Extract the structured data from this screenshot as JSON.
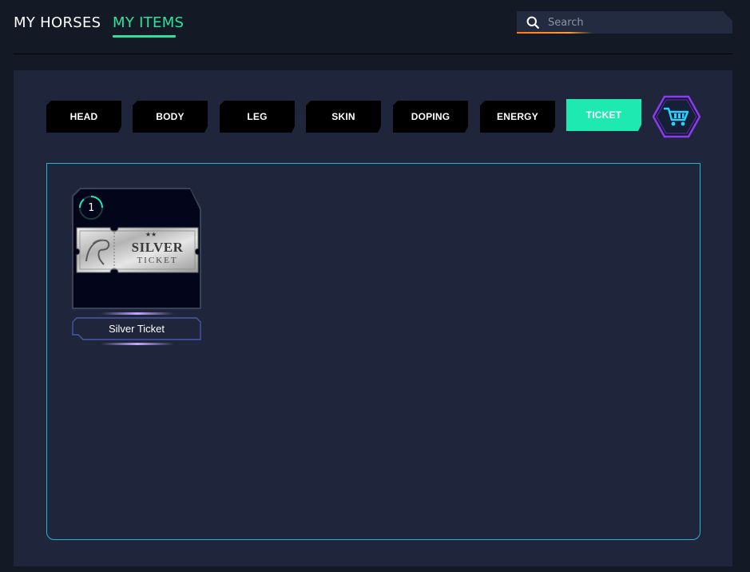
{
  "nav": {
    "tabs": [
      {
        "label": "MY HORSES",
        "active": false
      },
      {
        "label": "MY ITEMS",
        "active": true
      }
    ],
    "active_color": "#2de39a"
  },
  "search": {
    "placeholder": "Search",
    "value": "",
    "icon": "search-icon"
  },
  "categories": [
    {
      "label": "HEAD",
      "active": false
    },
    {
      "label": "BODY",
      "active": false
    },
    {
      "label": "LEG",
      "active": false
    },
    {
      "label": "SKIN",
      "active": false
    },
    {
      "label": "DOPING",
      "active": false
    },
    {
      "label": "ENERGY",
      "active": false
    },
    {
      "label": "TICKET",
      "active": true
    }
  ],
  "cart": {
    "icon": "shopping-cart-icon"
  },
  "items": [
    {
      "name": "Silver Ticket",
      "quantity": "1",
      "ticket_title": "SILVER",
      "ticket_subtitle": "TICKET"
    }
  ],
  "colors": {
    "accent": "#2de39a",
    "active_category": "#1de9b0",
    "grid_border": "#27b3d3",
    "search_underline": "#ff7a1a",
    "cart_outer": "#8a3df0",
    "cart_icon": "#24d4ff"
  }
}
